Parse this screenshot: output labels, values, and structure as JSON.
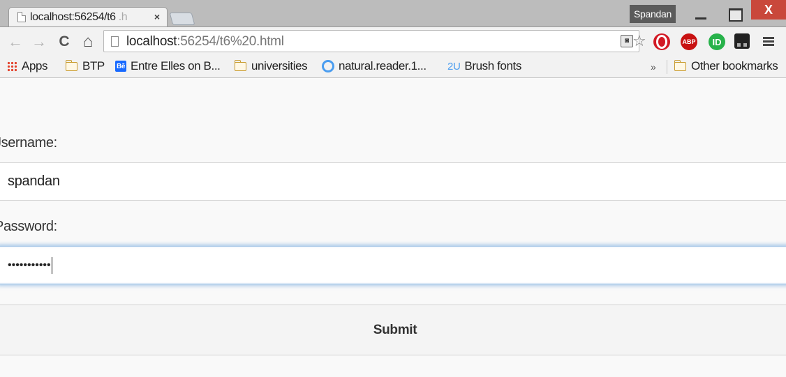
{
  "window": {
    "tab_title_visible": "localhost:56254/t6",
    "tab_title_fade": ".h",
    "tab_close": "×",
    "profile_name": "Spandan",
    "close_glyph": "X"
  },
  "toolbar": {
    "back_icon": "←",
    "forward_icon": "→",
    "reload_icon": "C",
    "home_icon": "⌂",
    "url_host": "localhost",
    "url_path": ":56254/t6%20.html",
    "star_icon": "☆",
    "abp_label": "ABP",
    "id_label": "ID"
  },
  "bookmarks": {
    "apps": "Apps",
    "items": [
      "BTP",
      "Entre Elles on B...",
      "universities",
      "natural.reader.1...",
      "Brush fonts"
    ],
    "behance_badge": "Bē",
    "brush_badge": "2U",
    "more": "»",
    "other": "Other bookmarks"
  },
  "form": {
    "username_label": "Jsername:",
    "username_value": "spandan",
    "password_label": "Password:",
    "password_value": "•••••••••••",
    "submit_label": "Submit"
  },
  "colors": {
    "close_button": "#c9483b",
    "focus_glow": "#6ea5dc",
    "profile_bg": "#5b5b5b"
  }
}
